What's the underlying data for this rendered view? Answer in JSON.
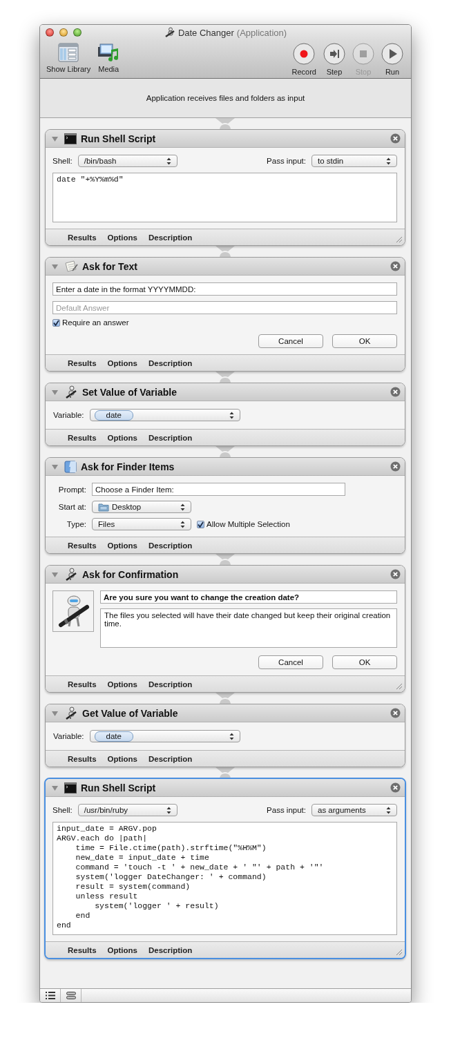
{
  "window": {
    "title": "Date Changer",
    "subtitle": "(Application)"
  },
  "toolbar": {
    "left": [
      {
        "label": "Show Library",
        "kind": "library"
      },
      {
        "label": "Media",
        "kind": "media"
      }
    ],
    "right": [
      {
        "label": "Record",
        "kind": "record",
        "disabled": false
      },
      {
        "label": "Step",
        "kind": "step",
        "disabled": false
      },
      {
        "label": "Stop",
        "kind": "stop",
        "disabled": true
      },
      {
        "label": "Run",
        "kind": "run",
        "disabled": false
      }
    ]
  },
  "workflow_input": "Application receives files and folders as input",
  "actions": [
    {
      "title": "Run Shell Script",
      "kind": "shell_script",
      "expanded": true,
      "selected": false,
      "resizable": true,
      "body": [
        {
          "kind": "shell",
          "shell_label": "Shell:",
          "shell": "/bin/bash",
          "pass_label": "Pass input:",
          "pass": "to stdin"
        },
        {
          "kind": "code",
          "lines": [
            "date \"+%Y%m%d\""
          ]
        }
      ],
      "tabs": [
        "Results",
        "Options",
        "Description"
      ]
    },
    {
      "title": "Ask for Text",
      "kind": "ask_text",
      "expanded": true,
      "selected": false,
      "resizable": false,
      "body": [
        {
          "kind": "field",
          "value": "Enter a date in the format YYYYMMDD:"
        },
        {
          "kind": "field",
          "placeholder": "Default Answer"
        },
        {
          "kind": "checkbox",
          "label": "Require an answer",
          "checked": true
        },
        {
          "kind": "buttons",
          "buttons": [
            "Cancel",
            "OK"
          ]
        }
      ],
      "tabs": [
        "Results",
        "Options",
        "Description"
      ]
    },
    {
      "title": "Set Value of Variable",
      "kind": "set_variable",
      "expanded": true,
      "selected": false,
      "resizable": false,
      "body": [
        {
          "kind": "variable",
          "label": "Variable:",
          "value": "date"
        }
      ],
      "tabs": [
        "Results",
        "Options",
        "Description"
      ]
    },
    {
      "title": "Ask for Finder Items",
      "kind": "ask_finder",
      "expanded": true,
      "selected": false,
      "resizable": false,
      "body": [
        {
          "kind": "form",
          "rows": [
            {
              "label": "Prompt:",
              "field": "Choose a Finder Item:"
            },
            {
              "label": "Start at:",
              "popup": "Desktop",
              "folder": true
            },
            {
              "label": "Type:",
              "popup": "Files",
              "folder": false,
              "checkbox": {
                "label": "Allow Multiple Selection",
                "checked": true
              }
            }
          ]
        }
      ],
      "tabs": [
        "Results",
        "Options",
        "Description"
      ]
    },
    {
      "title": "Ask for Confirmation",
      "kind": "confirmation",
      "expanded": true,
      "selected": false,
      "resizable": true,
      "body": [
        {
          "kind": "confirm",
          "title": "Are you sure you want to change the creation date?",
          "message": "The files you selected will have their date changed but keep their original creation time."
        },
        {
          "kind": "buttons",
          "buttons": [
            "Cancel",
            "OK"
          ]
        }
      ],
      "tabs": [
        "Results",
        "Options",
        "Description"
      ]
    },
    {
      "title": "Get Value of Variable",
      "kind": "get_variable",
      "expanded": true,
      "selected": false,
      "resizable": false,
      "body": [
        {
          "kind": "variable",
          "label": "Variable:",
          "value": "date"
        }
      ],
      "tabs": [
        "Results",
        "Options",
        "Description"
      ]
    },
    {
      "title": "Run Shell Script",
      "kind": "shell_script",
      "expanded": true,
      "selected": true,
      "resizable": true,
      "body": [
        {
          "kind": "shell",
          "shell_label": "Shell:",
          "shell": "/usr/bin/ruby",
          "pass_label": "Pass input:",
          "pass": "as arguments"
        },
        {
          "kind": "code",
          "lines": [
            "input_date = ARGV.pop",
            "ARGV.each do |path|",
            "    time = File.ctime(path).strftime(\"%H%M\")",
            "    new_date = input_date + time",
            "    command = 'touch -t ' + new_date + ' \"' + path + '\"'",
            "    system('logger DateChanger: ' + command)",
            "    result = system(command)",
            "    unless result",
            "        system('logger ' + result)",
            "    end",
            "end"
          ]
        }
      ],
      "tabs": [
        "Results",
        "Options",
        "Description"
      ]
    }
  ]
}
